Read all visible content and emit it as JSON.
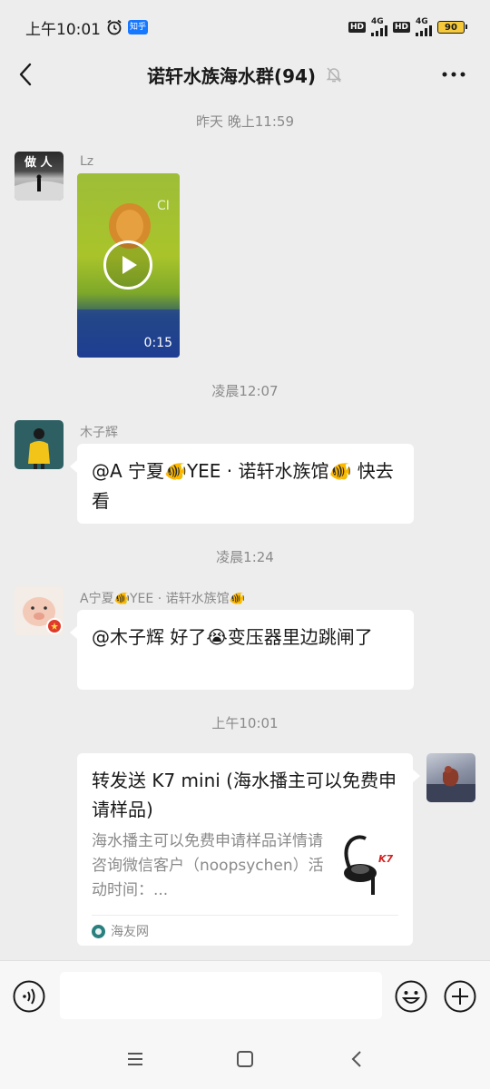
{
  "status_bar": {
    "time": "上午10:01",
    "app_badge": "知乎",
    "network_1": "4G",
    "network_2": "4G",
    "hd_label": "HD",
    "battery": "90"
  },
  "header": {
    "title": "诺轩水族海水群(94)",
    "muted_icon": "bell-off-icon",
    "back_icon": "chevron-left-icon",
    "more_icon": "more-dots-icon"
  },
  "messages": [
    {
      "type": "timestamp",
      "text": "昨天 晚上11:59"
    },
    {
      "type": "video",
      "sender": "Lz",
      "avatar_text": "做 人",
      "duration": "0:15"
    },
    {
      "type": "timestamp",
      "text": "凌晨12:07"
    },
    {
      "type": "text",
      "sender": "木子辉",
      "text": "@A 宁夏🐠YEE · 诺轩水族馆🐠 快去看"
    },
    {
      "type": "timestamp",
      "text": "凌晨1:24"
    },
    {
      "type": "text",
      "sender": "A宁夏🐠YEE · 诺轩水族馆🐠",
      "text": "@木子辉  好了😭变压器里边跳闸了"
    },
    {
      "type": "timestamp",
      "text": "上午10:01"
    },
    {
      "type": "link_card",
      "title": "转发送 K7 mini (海水播主可以免费申请样品)",
      "description": "海水播主可以免费申请样品详情请咨询微信客户（noopsychen）活动时间：...",
      "source": "海友网",
      "thumb_brand": "K7"
    }
  ],
  "input_bar": {
    "placeholder": "",
    "voice_icon": "voice-icon",
    "emoji_icon": "emoji-icon",
    "plus_icon": "plus-icon"
  },
  "nav_bar": {
    "menu_icon": "menu-icon",
    "home_icon": "home-square-icon",
    "back_icon": "back-triangle-icon"
  },
  "colors": {
    "background": "#ededed",
    "bubble": "#ffffff",
    "muted_text": "#8a8a8a",
    "battery": "#f5c93a"
  }
}
